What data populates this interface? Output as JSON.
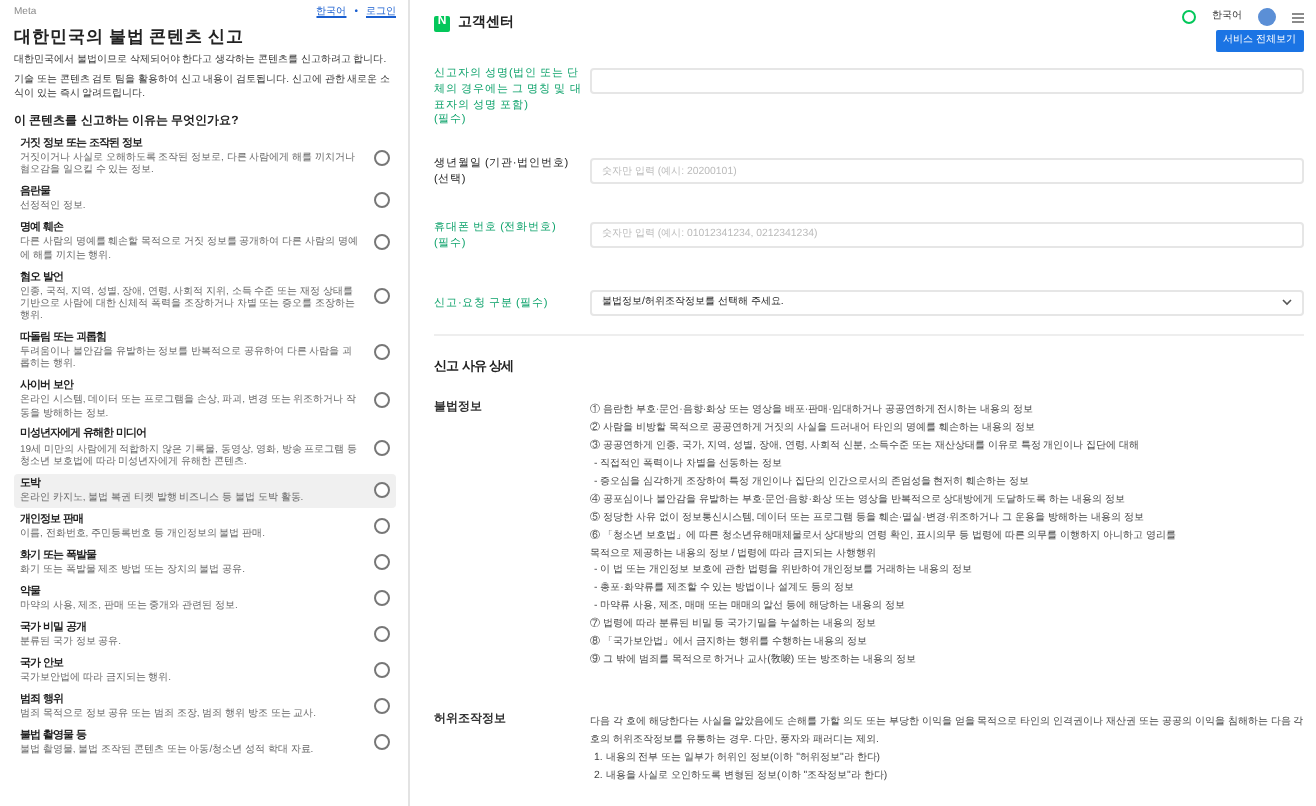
{
  "left": {
    "brand": "Meta",
    "language": "한국어",
    "separator": "•",
    "login": "로그인",
    "title": "대한민국의 불법 콘텐츠 신고",
    "paragraphs": [
      "대한민국에서 불법이므로 삭제되어야 한다고 생각하는 콘텐츠를 신고하려고 합니다.",
      "기술 또는 콘텐츠 검토 팀을 활용하여 신고 내용이 검토됩니다. 신고에 관한 새로운 소식이 있는 즉시 알려드립니다."
    ],
    "question": "이 콘텐츠를 신고하는 이유는 무엇인가요?",
    "options": [
      {
        "title": "거짓 정보 또는 조작된 정보",
        "description": "거짓이거나 사실로 오해하도록 조작된 정보로, 다른 사람에게 해를 끼치거나 혐오감을 일으킬 수 있는 정보.",
        "checked": false,
        "hovered": false
      },
      {
        "title": "음란물",
        "description": "선정적인 정보.",
        "checked": false,
        "hovered": false
      },
      {
        "title": "명예 훼손",
        "description": "다른 사람의 명예를 훼손할 목적으로 거짓 정보를 공개하여 다른 사람의 명예에 해를 끼치는 행위.",
        "checked": false,
        "hovered": false
      },
      {
        "title": "혐오 발언",
        "description": "인종, 국적, 지역, 성별, 장애, 연령, 사회적 지위, 소득 수준 또는 재정 상태를 기반으로 사람에 대한 신체적 폭력을 조장하거나 차별 또는 증오를 조장하는 행위.",
        "checked": false,
        "hovered": false
      },
      {
        "title": "따돌림 또는 괴롭힘",
        "description": "두려움이나 불안감을 유발하는 정보를 반복적으로 공유하여 다른 사람을 괴롭히는 행위.",
        "checked": false,
        "hovered": false
      },
      {
        "title": "사이버 보안",
        "description": "온라인 시스템, 데이터 또는 프로그램을 손상, 파괴, 변경 또는 위조하거나 작동을 방해하는 정보.",
        "checked": false,
        "hovered": false
      },
      {
        "title": "미성년자에게 유해한 미디어",
        "description": "19세 미만의 사람에게 적합하지 않은 기록물, 동영상, 영화, 방송 프로그램 등 청소년 보호법에 따라 미성년자에게 유해한 콘텐츠.",
        "checked": false,
        "hovered": false
      },
      {
        "title": "도박",
        "description": "온라인 카지노, 불법 복권 티켓 발행 비즈니스 등 불법 도박 활동.",
        "checked": false,
        "hovered": true
      },
      {
        "title": "개인정보 판매",
        "description": "이름, 전화번호, 주민등록번호 등 개인정보의 불법 판매.",
        "checked": false,
        "hovered": false
      },
      {
        "title": "화기 또는 폭발물",
        "description": "화기 또는 폭발물 제조 방법 또는 장치의 불법 공유.",
        "checked": false,
        "hovered": false
      },
      {
        "title": "약물",
        "description": "마약의 사용, 제조, 판매 또는 중개와 관련된 정보.",
        "checked": false,
        "hovered": false
      },
      {
        "title": "국가 비밀 공개",
        "description": "분류된 국가 정보 공유.",
        "checked": false,
        "hovered": false
      },
      {
        "title": "국가 안보",
        "description": "국가보안법에 따라 금지되는 행위.",
        "checked": false,
        "hovered": false
      },
      {
        "title": "범죄 행위",
        "description": "범죄 목적으로 정보 공유 또는 범죄 조장, 범죄 행위 방조 또는 교사.",
        "checked": false,
        "hovered": false
      },
      {
        "title": "불법 촬영물 등",
        "description": "불법 촬영물, 불법 조작된 콘텐츠 또는 아동/청소년 성적 학대 자료.",
        "checked": false,
        "hovered": false
      }
    ]
  },
  "right": {
    "logo": "N",
    "title": "고객센터",
    "language": "한국어",
    "service_button": "서비스 전체보기",
    "form": [
      {
        "kind": "input",
        "label": "신고자의 성명(법인 또는 단체의 경우에는 그 명칭 및 대표자의 성명 포함)",
        "tag": "(필수)",
        "required": true
      },
      {
        "kind": "input",
        "label": "생년월일 (기관·법인번호)",
        "tag": "(선택)",
        "required": false,
        "placeholder": "숫자만 입력 (예시: 20200101)"
      },
      {
        "kind": "input",
        "label": "휴대폰 번호 (전화번호)",
        "tag": "(필수)",
        "required": true,
        "placeholder": "숫자만 입력 (예시: 01012341234, 0212341234)"
      },
      {
        "kind": "select",
        "label": "신고·요청 구분",
        "tag": "(필수)",
        "required": true,
        "value": "불법정보/허위조작정보를 선택해 주세요."
      }
    ],
    "section_title": "신고 사유 상세",
    "details": [
      {
        "term": "불법정보",
        "lines": [
          {
            "kind": "item",
            "text": "① 음란한 부호·문언·음향·화상 또는 영상을 배포·판매·임대하거나 공공연하게 전시하는 내용의 정보"
          },
          {
            "kind": "item",
            "text": "② 사람을 비방할 목적으로 공공연하게 거짓의 사실을 드러내어 타인의 명예를 훼손하는 내용의 정보"
          },
          {
            "kind": "item",
            "text": "③ 공공연하게 인종, 국가, 지역, 성별, 장애, 연령, 사회적 신분, 소득수준 또는 재산상태를 이유로 특정 개인이나 집단에 대해"
          },
          {
            "kind": "sub",
            "text": "- 직접적인 폭력이나 차별을 선동하는 정보"
          },
          {
            "kind": "sub",
            "text": "- 증오심을 심각하게 조장하여 특정 개인이나 집단의 인간으로서의 존엄성을 현저히 훼손하는 정보"
          },
          {
            "kind": "item",
            "text": "④ 공포심이나 불안감을 유발하는 부호·문언·음향·화상 또는 영상을 반복적으로 상대방에게 도달하도록 하는 내용의 정보"
          },
          {
            "kind": "item",
            "text": "⑤ 정당한 사유 없이 정보통신시스템, 데이터 또는 프로그램 등을 훼손·멸실·변경·위조하거나 그 운용을 방해하는 내용의 정보"
          },
          {
            "kind": "item",
            "text": "⑥ 「청소년 보호법」에 따른 청소년유해매체물로서 상대방의 연령 확인, 표시의무 등 법령에 따른 의무를 이행하지 아니하고 영리를"
          },
          {
            "kind": "item",
            "text": "목적으로 제공하는 내용의 정보 / 법령에 따라 금지되는 사행행위"
          },
          {
            "kind": "sub",
            "text": "- 이 법 또는 개인정보 보호에 관한 법령을 위반하여 개인정보를 거래하는 내용의 정보"
          },
          {
            "kind": "sub",
            "text": "- 총포·화약류를 제조할 수 있는 방법이나 설계도 등의 정보"
          },
          {
            "kind": "sub",
            "text": "- 마약류 사용, 제조, 매매 또는 매매의 알선 등에 해당하는 내용의 정보"
          },
          {
            "kind": "item",
            "text": "⑦ 법령에 따라 분류된 비밀 등 국가기밀을 누설하는 내용의 정보"
          },
          {
            "kind": "item",
            "text": "⑧ 「국가보안법」에서 금지하는 행위를 수행하는 내용의 정보"
          },
          {
            "kind": "item",
            "text": "⑨ 그 밖에 범죄를 목적으로 하거나 교사(敎唆) 또는 방조하는 내용의 정보"
          }
        ]
      },
      {
        "term": "허위조작정보",
        "lines": [
          {
            "kind": "item",
            "text": "다음 각 호에 해당한다는 사실을 알았음에도 손해를 가할 의도 또는 부당한 이익을 얻을 목적으로 타인의 인격권이나 재산권 또는 공공의 이익을 침해하는 다음 각 호의 허위조작정보를 유통하는 경우. 다만, 풍자와 패러디는 제외."
          },
          {
            "kind": "sub",
            "text": "1. 내용의 전부 또는 일부가 허위인 정보(이하 \"허위정보\"라 한다)"
          },
          {
            "kind": "sub",
            "text": "2. 내용을 사실로 오인하도록 변형된 정보(이하 \"조작정보\"라 한다)"
          }
        ]
      }
    ]
  }
}
